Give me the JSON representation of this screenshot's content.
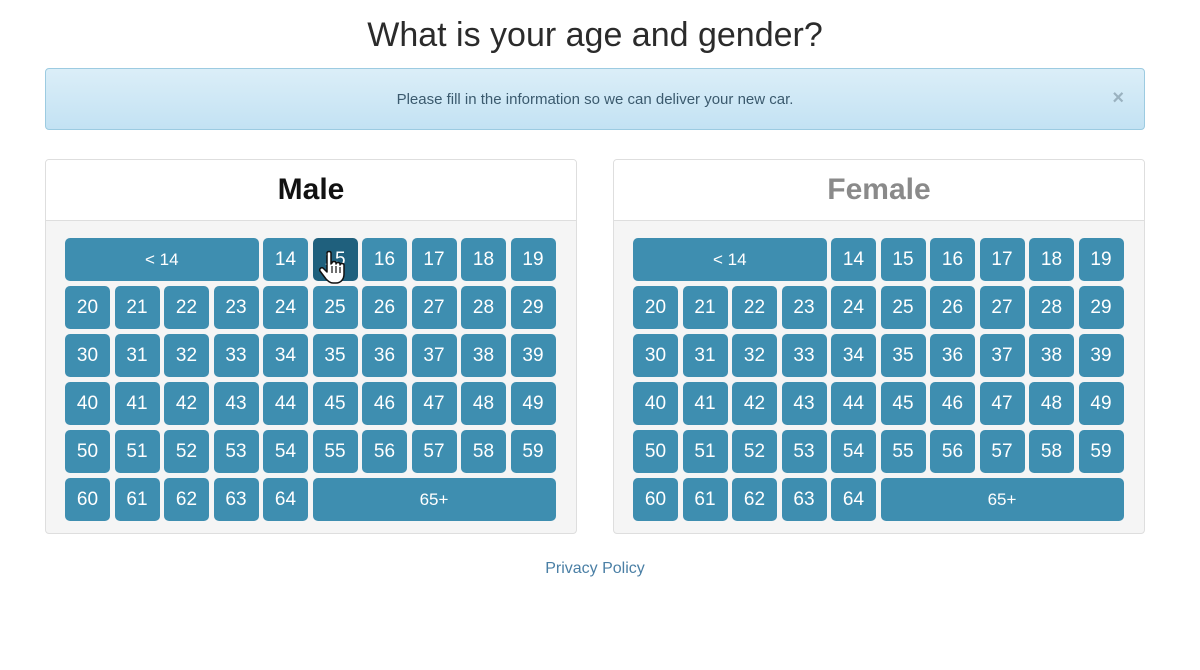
{
  "title": "What is your age and gender?",
  "alert": {
    "text": "Please fill in the information so we can deliver your new car.",
    "close": "×"
  },
  "male": {
    "heading": "Male",
    "buttons": [
      "< 14",
      "14",
      "15",
      "16",
      "17",
      "18",
      "19",
      "20",
      "21",
      "22",
      "23",
      "24",
      "25",
      "26",
      "27",
      "28",
      "29",
      "30",
      "31",
      "32",
      "33",
      "34",
      "35",
      "36",
      "37",
      "38",
      "39",
      "40",
      "41",
      "42",
      "43",
      "44",
      "45",
      "46",
      "47",
      "48",
      "49",
      "50",
      "51",
      "52",
      "53",
      "54",
      "55",
      "56",
      "57",
      "58",
      "59",
      "60",
      "61",
      "62",
      "63",
      "64",
      "65+"
    ],
    "active": "15"
  },
  "female": {
    "heading": "Female",
    "buttons": [
      "< 14",
      "14",
      "15",
      "16",
      "17",
      "18",
      "19",
      "20",
      "21",
      "22",
      "23",
      "24",
      "25",
      "26",
      "27",
      "28",
      "29",
      "30",
      "31",
      "32",
      "33",
      "34",
      "35",
      "36",
      "37",
      "38",
      "39",
      "40",
      "41",
      "42",
      "43",
      "44",
      "45",
      "46",
      "47",
      "48",
      "49",
      "50",
      "51",
      "52",
      "53",
      "54",
      "55",
      "56",
      "57",
      "58",
      "59",
      "60",
      "61",
      "62",
      "63",
      "64",
      "65+"
    ]
  },
  "footer": {
    "privacy_link": "Privacy Policy"
  },
  "colors": {
    "button": "#3e8eb0",
    "button_active": "#1f607d",
    "alert_bg": "#c3e2f3"
  },
  "icons": {
    "cursor": "hand-pointer-icon",
    "close": "close-icon"
  }
}
